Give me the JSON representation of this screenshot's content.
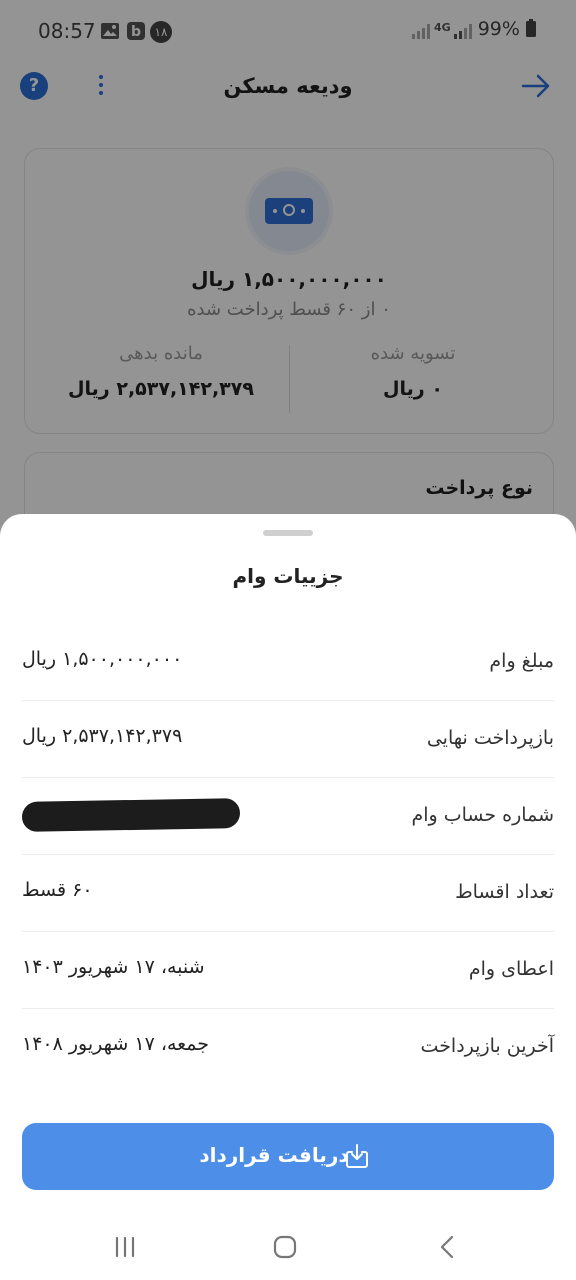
{
  "status_bar": {
    "time": "08:57",
    "badge": "۱۸",
    "network": "4G",
    "battery": "99%"
  },
  "header": {
    "title": "ودیعه مسکن",
    "help_label": "?"
  },
  "summary": {
    "amount": "۱,۵۰۰,۰۰۰,۰۰۰ ریال",
    "progress": "۰ از ۶۰ قسط پرداخت شده",
    "remaining_label": "مانده بدهی",
    "remaining_value": "۲,۵۳۷,۱۴۲,۳۷۹ ریال",
    "settled_label": "تسویه شده",
    "settled_value": "۰ ریال"
  },
  "payment_type": {
    "title": "نوع پرداخت"
  },
  "sheet": {
    "title": "جزییات وام",
    "rows": [
      {
        "label": "مبلغ وام",
        "value": "۱,۵۰۰,۰۰۰,۰۰۰ ریال"
      },
      {
        "label": "بازپرداخت نهایی",
        "value": "۲,۵۳۷,۱۴۲,۳۷۹ ریال"
      },
      {
        "label": "شماره حساب وام",
        "value": ""
      },
      {
        "label": "تعداد اقساط",
        "value": "۶۰ قسط"
      },
      {
        "label": "اعطای وام",
        "value": "شنبه، ۱۷ شهریور ۱۴۰۳"
      },
      {
        "label": "آخرین بازپرداخت",
        "value": "جمعه، ۱۷ شهریور ۱۴۰۸"
      }
    ],
    "button_label": "دریافت قرارداد"
  },
  "colors": {
    "accent": "#2a6fd6",
    "button": "#4c8ee8"
  }
}
